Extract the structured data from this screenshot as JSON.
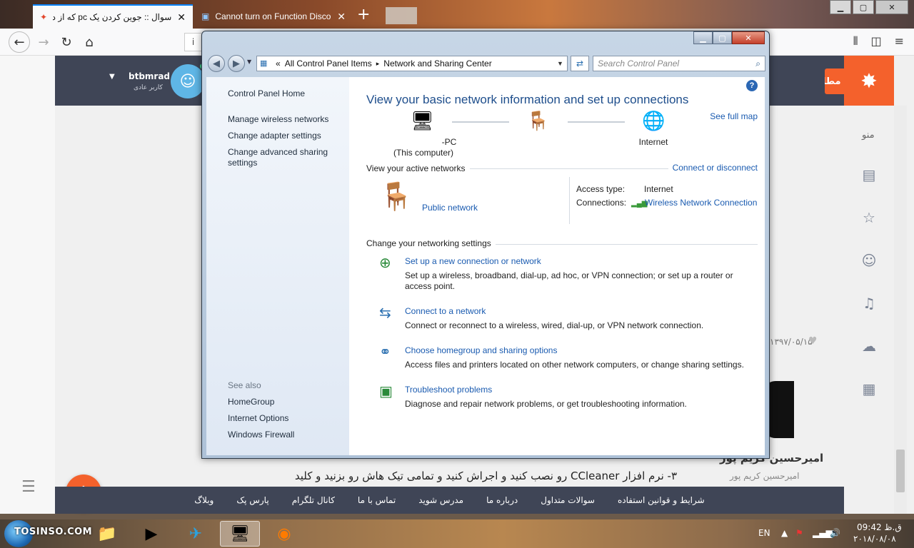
{
  "browser": {
    "tabs": [
      {
        "title": "سوال :: جوین کردن یک pc که از دومین",
        "icon": "tosinso-icon",
        "active": true
      },
      {
        "title": "Cannot turn on Function Disco",
        "icon": "page-icon",
        "active": false
      }
    ],
    "new_tab_label": "+",
    "url_info": "i"
  },
  "site": {
    "user_name": "btbmrad",
    "user_role": "کاربر عادی",
    "send_button": "ارسال مطلب",
    "rail_menu": "منو",
    "article_date": "۱۳۹۷/۰۵/۱۵",
    "author_name": "امیرحسین کریم پور",
    "author_sub": "امیرحسین کریم پور",
    "article_text": "۳- نرم افزار CCleaner رو نصب کنید و اجراش کنید و تمامی تیک هاش رو بزنید و کلید",
    "footer_links": [
      "شرایط و قوانین استفاده",
      "سوالات متداول",
      "درباره ما",
      "مدرس شوید",
      "تماس با ما",
      "کانال تلگرام",
      "پارس پک",
      "وبلاگ"
    ],
    "brand_color": "#f4612c",
    "header_color": "#3f4556"
  },
  "control_panel": {
    "breadcrumb": {
      "prefix": "«",
      "items": [
        "All Control Panel Items",
        "Network and Sharing Center"
      ],
      "separator": "▸"
    },
    "search_placeholder": "Search Control Panel",
    "sidebar": {
      "home": "Control Panel Home",
      "links": [
        "Manage wireless networks",
        "Change adapter settings",
        "Change advanced sharing settings"
      ],
      "see_also_label": "See also",
      "see_also": [
        "HomeGroup",
        "Internet Options",
        "Windows Firewall"
      ]
    },
    "main": {
      "title": "View your basic network information and set up connections",
      "see_full_map": "See full map",
      "map": {
        "computer_name": "-PC",
        "computer_sub": "(This computer)",
        "internet": "Internet"
      },
      "active_networks_label": "View your active networks",
      "connect_or_disconnect": "Connect or disconnect",
      "network_name": "Public network",
      "access_type_key": "Access type:",
      "access_type_val": "Internet",
      "connections_key": "Connections:",
      "connections_val": "Wireless Network Connection",
      "change_settings_label": "Change your networking settings",
      "tasks": [
        {
          "title": "Set up a new connection or network",
          "desc": "Set up a wireless, broadband, dial-up, ad hoc, or VPN connection; or set up a router or access point.",
          "icon": "new-connection-icon"
        },
        {
          "title": "Connect to a network",
          "desc": "Connect or reconnect to a wireless, wired, dial-up, or VPN network connection.",
          "icon": "connect-network-icon"
        },
        {
          "title": "Choose homegroup and sharing options",
          "desc": "Access files and printers located on other network computers, or change sharing settings.",
          "icon": "homegroup-icon"
        },
        {
          "title": "Troubleshoot problems",
          "desc": "Diagnose and repair network problems, or get troubleshooting information.",
          "icon": "troubleshoot-icon"
        }
      ]
    }
  },
  "taskbar": {
    "watermark": "TOSINSO.COM",
    "language": "EN",
    "time": "ق.ظ 09:42",
    "date": "۲۰۱۸/۰۸/۰۸"
  }
}
